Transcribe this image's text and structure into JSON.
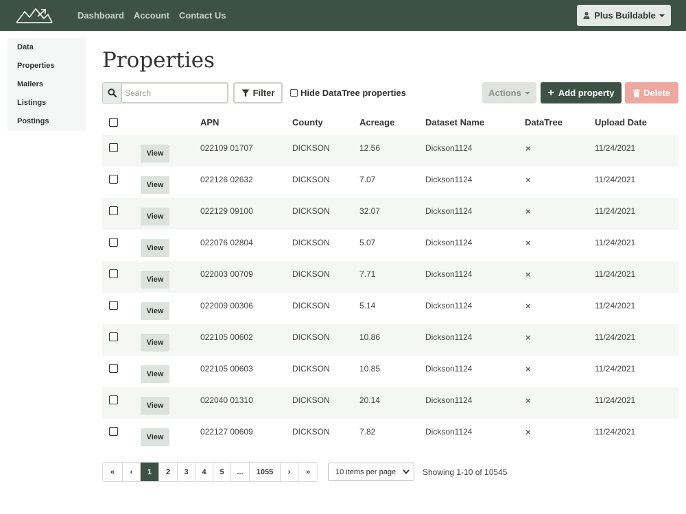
{
  "nav": {
    "links": [
      "Dashboard",
      "Account",
      "Contact Us"
    ],
    "user_label": "Plus Buildable"
  },
  "sidebar": {
    "items": [
      "Data",
      "Properties",
      "Mailers",
      "Listings",
      "Postings"
    ]
  },
  "page": {
    "title": "Properties"
  },
  "toolbar": {
    "search_placeholder": "Search",
    "filter_label": "Filter",
    "hide_datatree_label": "Hide DataTree properties",
    "actions_label": "Actions",
    "add_label": "Add property",
    "delete_label": "Delete"
  },
  "table": {
    "headers": [
      "APN",
      "County",
      "Acreage",
      "Dataset Name",
      "DataTree",
      "Upload Date"
    ],
    "view_label": "View",
    "rows": [
      {
        "apn": "022109 01707",
        "county": "DICKSON",
        "acreage": "12.56",
        "dataset": "Dickson1124",
        "datatree": "×",
        "date": "11/24/2021"
      },
      {
        "apn": "022126 02632",
        "county": "DICKSON",
        "acreage": "7.07",
        "dataset": "Dickson1124",
        "datatree": "×",
        "date": "11/24/2021"
      },
      {
        "apn": "022129 09100",
        "county": "DICKSON",
        "acreage": "32.07",
        "dataset": "Dickson1124",
        "datatree": "×",
        "date": "11/24/2021"
      },
      {
        "apn": "022076 02804",
        "county": "DICKSON",
        "acreage": "5.07",
        "dataset": "Dickson1124",
        "datatree": "×",
        "date": "11/24/2021"
      },
      {
        "apn": "022003 00709",
        "county": "DICKSON",
        "acreage": "7.71",
        "dataset": "Dickson1124",
        "datatree": "×",
        "date": "11/24/2021"
      },
      {
        "apn": "022009 00306",
        "county": "DICKSON",
        "acreage": "5.14",
        "dataset": "Dickson1124",
        "datatree": "×",
        "date": "11/24/2021"
      },
      {
        "apn": "022105 00602",
        "county": "DICKSON",
        "acreage": "10.86",
        "dataset": "Dickson1124",
        "datatree": "×",
        "date": "11/24/2021"
      },
      {
        "apn": "022105 00603",
        "county": "DICKSON",
        "acreage": "10.85",
        "dataset": "Dickson1124",
        "datatree": "×",
        "date": "11/24/2021"
      },
      {
        "apn": "022040 01310",
        "county": "DICKSON",
        "acreage": "20.14",
        "dataset": "Dickson1124",
        "datatree": "×",
        "date": "11/24/2021"
      },
      {
        "apn": "022127 00609",
        "county": "DICKSON",
        "acreage": "7.82",
        "dataset": "Dickson1124",
        "datatree": "×",
        "date": "11/24/2021"
      }
    ]
  },
  "pagination": {
    "first": "«",
    "prev": "‹",
    "pages": [
      "1",
      "2",
      "3",
      "4",
      "5",
      "...",
      "1055"
    ],
    "current": "1",
    "next": "›",
    "last": "»",
    "per_page": "10 items per page",
    "showing": "Showing 1-10 of 10545"
  },
  "colors": {
    "brand": "#3d5245",
    "delete": "#eda8a0",
    "row_stripe": "#f4f7f4"
  }
}
